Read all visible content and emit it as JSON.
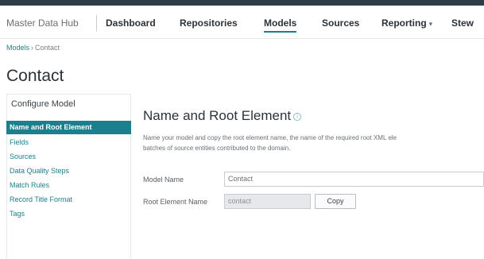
{
  "nav": {
    "brand": "Master Data Hub",
    "items": [
      {
        "label": "Dashboard"
      },
      {
        "label": "Repositories"
      },
      {
        "label": "Models"
      },
      {
        "label": "Sources"
      },
      {
        "label": "Reporting",
        "caret": "▾"
      },
      {
        "label": "Stew"
      }
    ]
  },
  "breadcrumb": {
    "parent": "Models",
    "separator": "›",
    "current": "Contact"
  },
  "page_title": "Contact",
  "sidebar": {
    "heading": "Configure Model",
    "items": [
      {
        "label": "Name and Root Element"
      },
      {
        "label": "Fields"
      },
      {
        "label": "Sources"
      },
      {
        "label": "Data Quality Steps"
      },
      {
        "label": "Match Rules"
      },
      {
        "label": "Record Title Format"
      },
      {
        "label": "Tags"
      }
    ]
  },
  "main": {
    "title": "Name and Root Element",
    "info_glyph": "i",
    "description_line1": "Name your model and copy the root element name, the name of the required root XML ele",
    "description_line2": "batches of source entities contributed to the domain.",
    "model_name_label": "Model Name",
    "model_name_value": "Contact",
    "root_element_label": "Root Element Name",
    "root_element_value": "contact",
    "copy_label": "Copy"
  },
  "colors": {
    "accent": "#1b7f8e",
    "topbar": "#2d3e48"
  }
}
